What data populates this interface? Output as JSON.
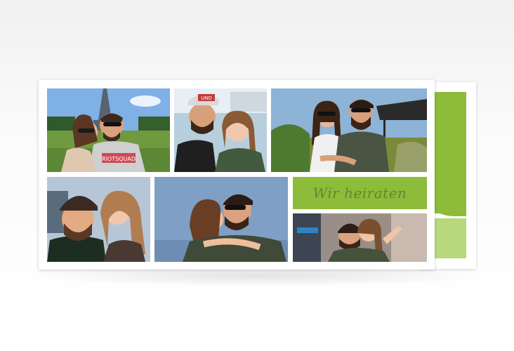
{
  "card": {
    "title": "Wir heiraten"
  },
  "colors": {
    "accent_green": "#8dbb3a",
    "light_green": "#b9d77b",
    "title_text": "#5e8a2b"
  },
  "photos": [
    {
      "name": "photo-eiffel-tower-selfie",
      "shirt_text": "RIOTSQUAD"
    },
    {
      "name": "photo-seaside-selfie",
      "cap_text": "UND"
    },
    {
      "name": "photo-park-sunglasses"
    },
    {
      "name": "photo-kiss-selfie"
    },
    {
      "name": "photo-sunglasses-kiss"
    },
    {
      "name": "photo-city-selfie"
    }
  ]
}
